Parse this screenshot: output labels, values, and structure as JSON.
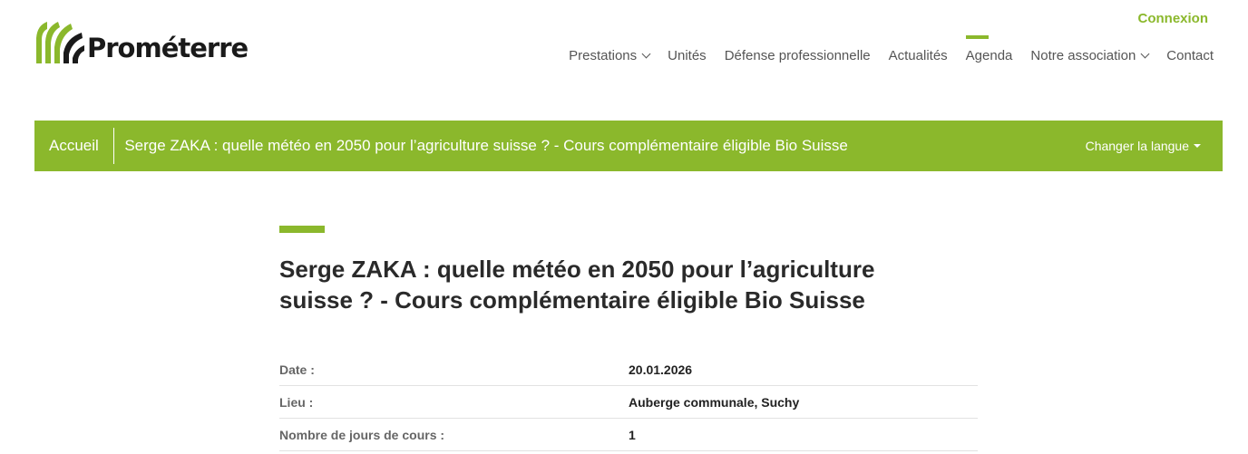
{
  "brand": {
    "name": "Prométerre",
    "accent": "#8bb82c"
  },
  "header": {
    "login_label": "Connexion"
  },
  "nav": {
    "items": [
      {
        "label": "Prestations",
        "dropdown": true
      },
      {
        "label": "Unités",
        "dropdown": false
      },
      {
        "label": "Défense professionnelle",
        "dropdown": false
      },
      {
        "label": "Actualités",
        "dropdown": false
      },
      {
        "label": "Agenda",
        "dropdown": false,
        "active": true
      },
      {
        "label": "Notre association",
        "dropdown": true
      },
      {
        "label": "Contact",
        "dropdown": false
      }
    ]
  },
  "breadcrumb": {
    "home": "Accueil",
    "current": "Serge ZAKA : quelle météo en 2050 pour l’agriculture suisse ? - Cours complémentaire éligible Bio Suisse",
    "language_label": "Changer la langue"
  },
  "page": {
    "title": "Serge ZAKA : quelle météo en 2050 pour l’agriculture suisse ? - Cours complémentaire éligible Bio Suisse"
  },
  "details": [
    {
      "label": "Date :",
      "value": "20.01.2026"
    },
    {
      "label": "Lieu :",
      "value": "Auberge communale, Suchy"
    },
    {
      "label": "Nombre de jours de cours :",
      "value": "1"
    }
  ]
}
